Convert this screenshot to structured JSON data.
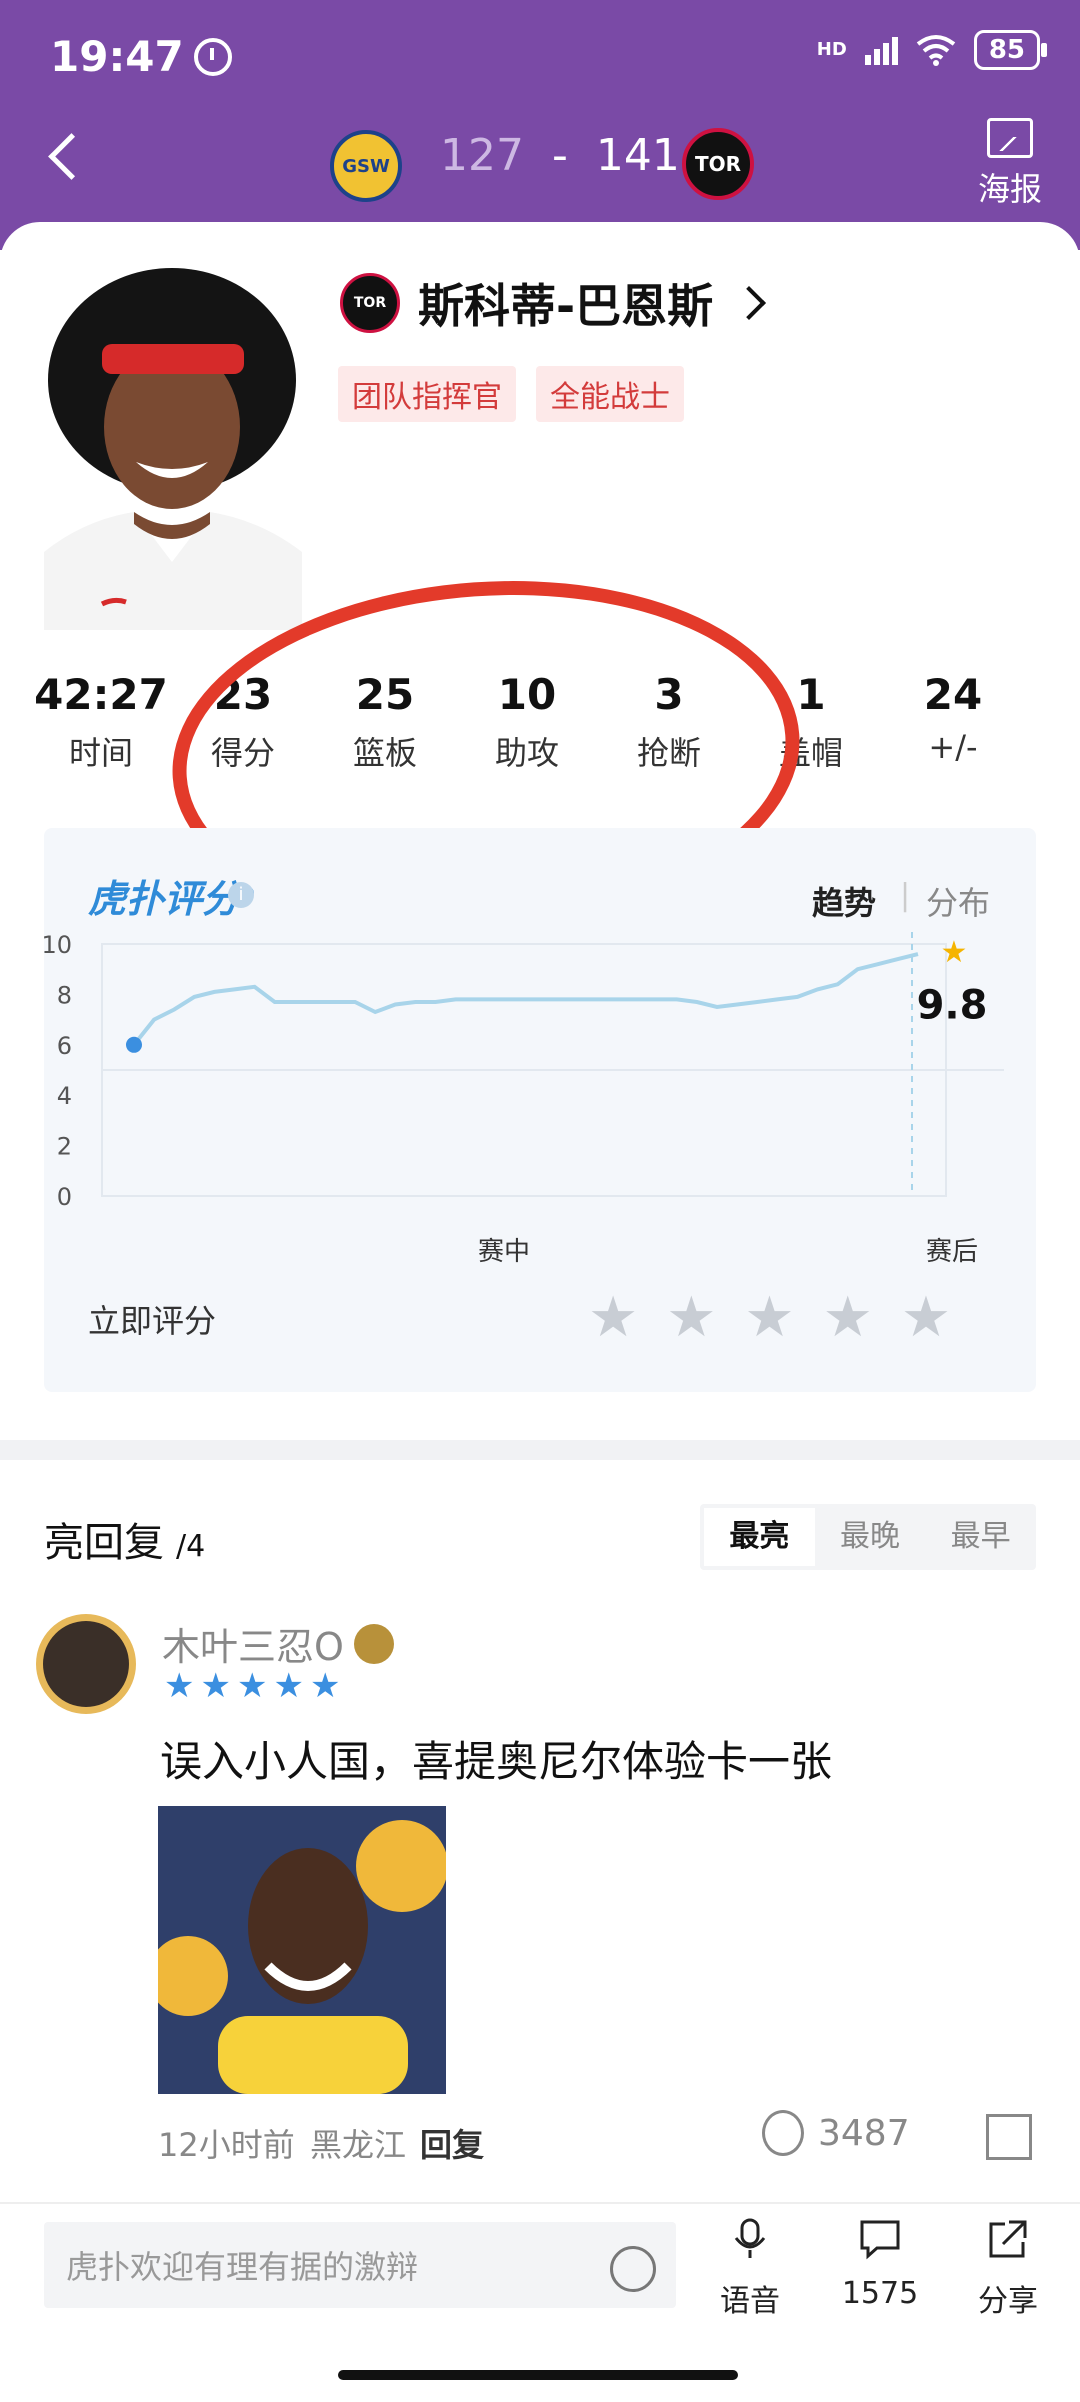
{
  "status": {
    "time": "19:47",
    "hd": "HD",
    "battery": "85"
  },
  "header": {
    "away_team": "GSW",
    "home_team": "TOR",
    "away_score": "127",
    "separator": "-",
    "home_score": "141",
    "poster_label": "海报"
  },
  "player": {
    "team_abbr": "TOR",
    "name": "斯科蒂-巴恩斯",
    "tags": [
      "团队指挥官",
      "全能战士"
    ]
  },
  "stats": [
    {
      "value": "42:27",
      "label": "时间"
    },
    {
      "value": "23",
      "label": "得分"
    },
    {
      "value": "25",
      "label": "篮板"
    },
    {
      "value": "10",
      "label": "助攻"
    },
    {
      "value": "3",
      "label": "抢断"
    },
    {
      "value": "1",
      "label": "盖帽"
    },
    {
      "value": "24",
      "label": "+/-"
    }
  ],
  "rating": {
    "logo": "虎扑评分",
    "logo_mark": "®",
    "info": "i",
    "tabs": {
      "trend": "趋势",
      "separator": "|",
      "distribution": "分布"
    },
    "rate_now_label": "立即评分",
    "input_stars": 5
  },
  "chart_data": {
    "type": "line",
    "ylim": [
      0,
      10
    ],
    "yticks": [
      "0",
      "2",
      "4",
      "6",
      "8",
      "10"
    ],
    "xticks": {
      "mid": "赛中",
      "end": "赛后"
    },
    "final_value": "9.8",
    "values": [
      6.0,
      7.0,
      7.4,
      7.9,
      8.1,
      8.2,
      8.3,
      7.7,
      7.7,
      7.7,
      7.7,
      7.7,
      7.3,
      7.6,
      7.7,
      7.7,
      7.8,
      7.8,
      7.8,
      7.8,
      7.8,
      7.8,
      7.8,
      7.8,
      7.8,
      7.8,
      7.8,
      7.8,
      7.7,
      7.5,
      7.6,
      7.7,
      7.8,
      7.9,
      8.2,
      8.4,
      9.0,
      9.2,
      9.4,
      9.6
    ],
    "colors": {
      "line": "#a8d4ea",
      "start_point": "#3b8fe0",
      "star": "#f5b400",
      "grid": "#e2e8ef"
    }
  },
  "replies": {
    "title": "亮回复",
    "count": "/4",
    "sort_tabs": [
      "最亮",
      "最晚",
      "最早"
    ],
    "items": [
      {
        "username": "木叶三忍O",
        "stars": 5,
        "text": "误入小人国，喜提奥尼尔体验卡一张",
        "time": "12小时前",
        "location": "黑龙江",
        "reply_label": "回复",
        "lights": "3487"
      }
    ]
  },
  "bottom": {
    "input_placeholder": "虎扑欢迎有理有据的激辩",
    "voice_label": "语音",
    "comment_count": "1575",
    "share_label": "分享"
  },
  "colors": {
    "header_bg": "#7a4aa6",
    "annotation_circle": "#e33a2a",
    "tag_bg": "#fde9e9",
    "tag_text": "#d33b3b",
    "rating_logo": "#2f8bd8"
  }
}
